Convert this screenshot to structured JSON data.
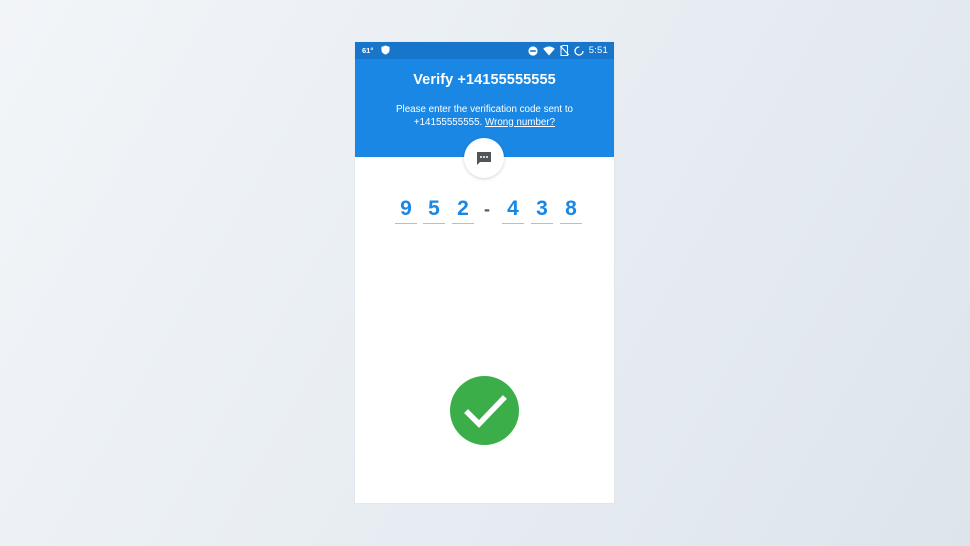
{
  "status_bar": {
    "temperature": "61°",
    "time": "5:51",
    "icons": [
      "shield-icon",
      "do-not-disturb-icon",
      "wifi-icon",
      "no-sim-icon",
      "battery-charging-icon"
    ]
  },
  "header": {
    "title": "Verify +14155555555",
    "instructions": "Please enter the verification code sent to +14155555555.",
    "wrong_number_link": "Wrong number?"
  },
  "sms_badge": {
    "icon": "sms-message-icon"
  },
  "code": {
    "digits": [
      "9",
      "5",
      "2",
      "4",
      "3",
      "8"
    ],
    "separator": "-"
  },
  "success": {
    "icon": "checkmark-icon"
  },
  "colors": {
    "status_bar": "#1776cc",
    "header": "#1a87e5",
    "digit": "#1a87e5",
    "success": "#3cae49"
  }
}
